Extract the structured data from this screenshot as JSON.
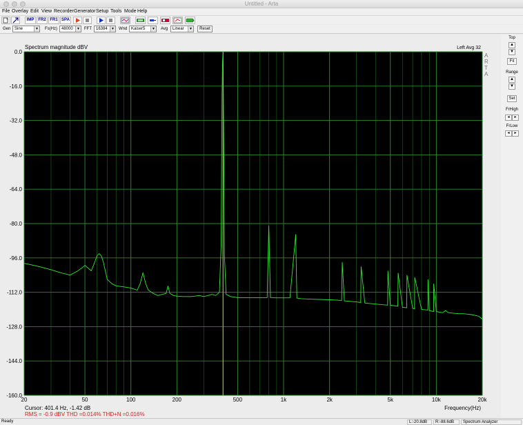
{
  "window": {
    "title": "Untitled - Arta"
  },
  "menu": [
    "File",
    "Overlay",
    "Edit",
    "View",
    "Recorder",
    "Generator",
    "Setup",
    "Tools",
    "Mode",
    "Help"
  ],
  "toolbar": {
    "imp": "IMP",
    "fr2": "FR2",
    "fr1": "FR1",
    "spa": "SPA"
  },
  "generator": {
    "gen_label": "Gen",
    "gen_value": "Sine",
    "fs_label": "Fs(Hz)",
    "fs_value": "48000",
    "fft_label": "FFT",
    "fft_value": "16384",
    "wnd_label": "Wnd",
    "wnd_value": "Kaiser5",
    "avg_label": "Avg",
    "avg_value": "Linear",
    "reset_label": "Reset"
  },
  "plot": {
    "title": "Spectrum magnitude dBV",
    "channel_info": "Left  Avg 32",
    "watermark": [
      "A",
      "R",
      "T",
      "A"
    ],
    "cursor_text": "Cursor:   401.4 Hz, -1.42 dB",
    "stats_text": "RMS =  -0.9 dBV   THD =0.014%   THD+N =0.016%"
  },
  "chart_data": {
    "type": "line",
    "ylabel": "Spectrum magnitude dBV",
    "xlabel": "Frequency(Hz)",
    "x_scale": "log",
    "xlim": [
      20,
      20000
    ],
    "ylim": [
      -160,
      0
    ],
    "y_ticks": [
      "0.0",
      "-16.0",
      "-32.0",
      "-48.0",
      "-64.0",
      "-80.0",
      "-96.0",
      "-112.0",
      "-128.0",
      "-144.0",
      "-160.0"
    ],
    "y_tick_values": [
      0,
      -16,
      -32,
      -48,
      -64,
      -80,
      -96,
      -112,
      -128,
      -144,
      -160
    ],
    "x_ticks": [
      "20",
      "50",
      "100",
      "200",
      "500",
      "1k",
      "2k",
      "5k",
      "10k",
      "20k"
    ],
    "x_tick_values": [
      20,
      50,
      100,
      200,
      500,
      1000,
      2000,
      5000,
      10000,
      20000
    ],
    "grid": true,
    "cursor_x": 401.4,
    "series": [
      {
        "line_color": "#2ee82e",
        "x": [
          20,
          25,
          30,
          35,
          40,
          45,
          48,
          50,
          52,
          55,
          58,
          60,
          62,
          64,
          66,
          70,
          75,
          80,
          90,
          100,
          110,
          115,
          120,
          125,
          130,
          140,
          150,
          160,
          170,
          175,
          180,
          190,
          200,
          220,
          250,
          280,
          300,
          320,
          340,
          360,
          380,
          390,
          395,
          398,
          400,
          402,
          405,
          410,
          420,
          450,
          500,
          600,
          700,
          780,
          800,
          820,
          900,
          1100,
          1200,
          1220,
          1300,
          1500,
          2000,
          2400,
          2420,
          2500,
          3000,
          3200,
          3220,
          3400,
          4000,
          4800,
          4820,
          5000,
          5600,
          5620,
          6000,
          6400,
          6420,
          7000,
          7200,
          7220,
          8000,
          8800,
          8820,
          9000,
          9600,
          9620,
          10000,
          11000,
          11500,
          12000,
          13000,
          14000,
          15000,
          16000,
          17000,
          18000,
          19000,
          20000
        ],
        "y": [
          -98.5,
          -100,
          -101.5,
          -103,
          -104,
          -102,
          -100.5,
          -99.5,
          -100.5,
          -102,
          -98,
          -95,
          -94,
          -95,
          -98,
          -106,
          -108,
          -109,
          -109.5,
          -110,
          -111,
          -108,
          -103,
          -108,
          -111,
          -112.5,
          -113.5,
          -113,
          -112.5,
          -109,
          -112.5,
          -113.5,
          -113.8,
          -114,
          -114,
          -113.5,
          -114,
          -113.5,
          -113,
          -113.5,
          -112,
          -90,
          -20,
          -5,
          -1.42,
          -8,
          -40,
          -95,
          -113,
          -114,
          -114.5,
          -114.5,
          -114.5,
          -114.5,
          -81,
          -114.5,
          -114.6,
          -114.6,
          -85,
          -114.7,
          -115,
          -115.2,
          -115.5,
          -115.8,
          -98,
          -116,
          -116.5,
          -116.8,
          -100,
          -117,
          -117.5,
          -118,
          -102,
          -118,
          -118.5,
          -103,
          -119,
          -119.2,
          -104,
          -119.5,
          -119.8,
          -105,
          -120,
          -120.3,
          -106,
          -120.5,
          -121,
          -108,
          -121,
          -121.5,
          -120.5,
          -121.5,
          -121.8,
          -122,
          -122,
          -122.2,
          -122.4,
          -122.8,
          -123.2,
          -124.5
        ]
      }
    ]
  },
  "side": {
    "top_label": "Top",
    "fit_label": "Fit",
    "range_label": "Range",
    "set_label": "Set",
    "frhigh_label": "FrHigh",
    "frlow_label": "FrLow"
  },
  "status": {
    "ready": "Ready",
    "left_level": "L:-20.8dB",
    "right_level": "R:-88.6dB",
    "mode": "Spectrum Analyzer"
  }
}
